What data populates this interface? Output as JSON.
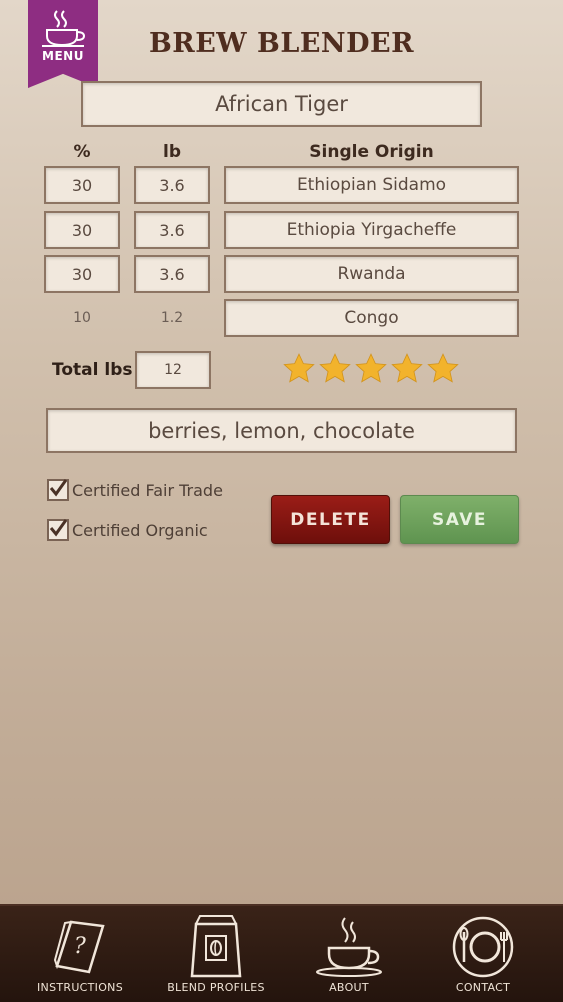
{
  "menu": {
    "label": "MENU",
    "icon": "coffee-cup-icon"
  },
  "app_title": "BREW BLENDER",
  "blend_name": "African Tiger",
  "columns": {
    "percent": "%",
    "lb": "lb",
    "origin": "Single Origin"
  },
  "rows": [
    {
      "percent": "30",
      "lb": "3.6",
      "origin": "Ethiopian Sidamo"
    },
    {
      "percent": "30",
      "lb": "3.6",
      "origin": "Ethiopia Yirgacheffe"
    },
    {
      "percent": "30",
      "lb": "3.6",
      "origin": "Rwanda"
    },
    {
      "percent": "10",
      "lb": "1.2",
      "origin": "Congo"
    }
  ],
  "total": {
    "label": "Total lbs",
    "value": "12"
  },
  "rating": {
    "stars": 5,
    "max": 5,
    "color": "#f2b32c"
  },
  "notes": "berries, lemon, chocolate",
  "certifications": [
    {
      "label": "Certified Fair Trade",
      "checked": true
    },
    {
      "label": "Certified Organic",
      "checked": true
    }
  ],
  "buttons": {
    "delete": "DELETE",
    "save": "SAVE"
  },
  "tabs": [
    {
      "label": "INSTRUCTIONS",
      "icon": "instructions-book-icon"
    },
    {
      "label": "BLEND PROFILES",
      "icon": "coffee-bag-icon"
    },
    {
      "label": "ABOUT",
      "icon": "steaming-cup-icon"
    },
    {
      "label": "CONTACT",
      "icon": "plate-setting-icon"
    }
  ],
  "colors": {
    "accent": "#8e2d82",
    "delete": "#8a1a14",
    "save": "#6fa35d",
    "title": "#4f2d1f"
  }
}
